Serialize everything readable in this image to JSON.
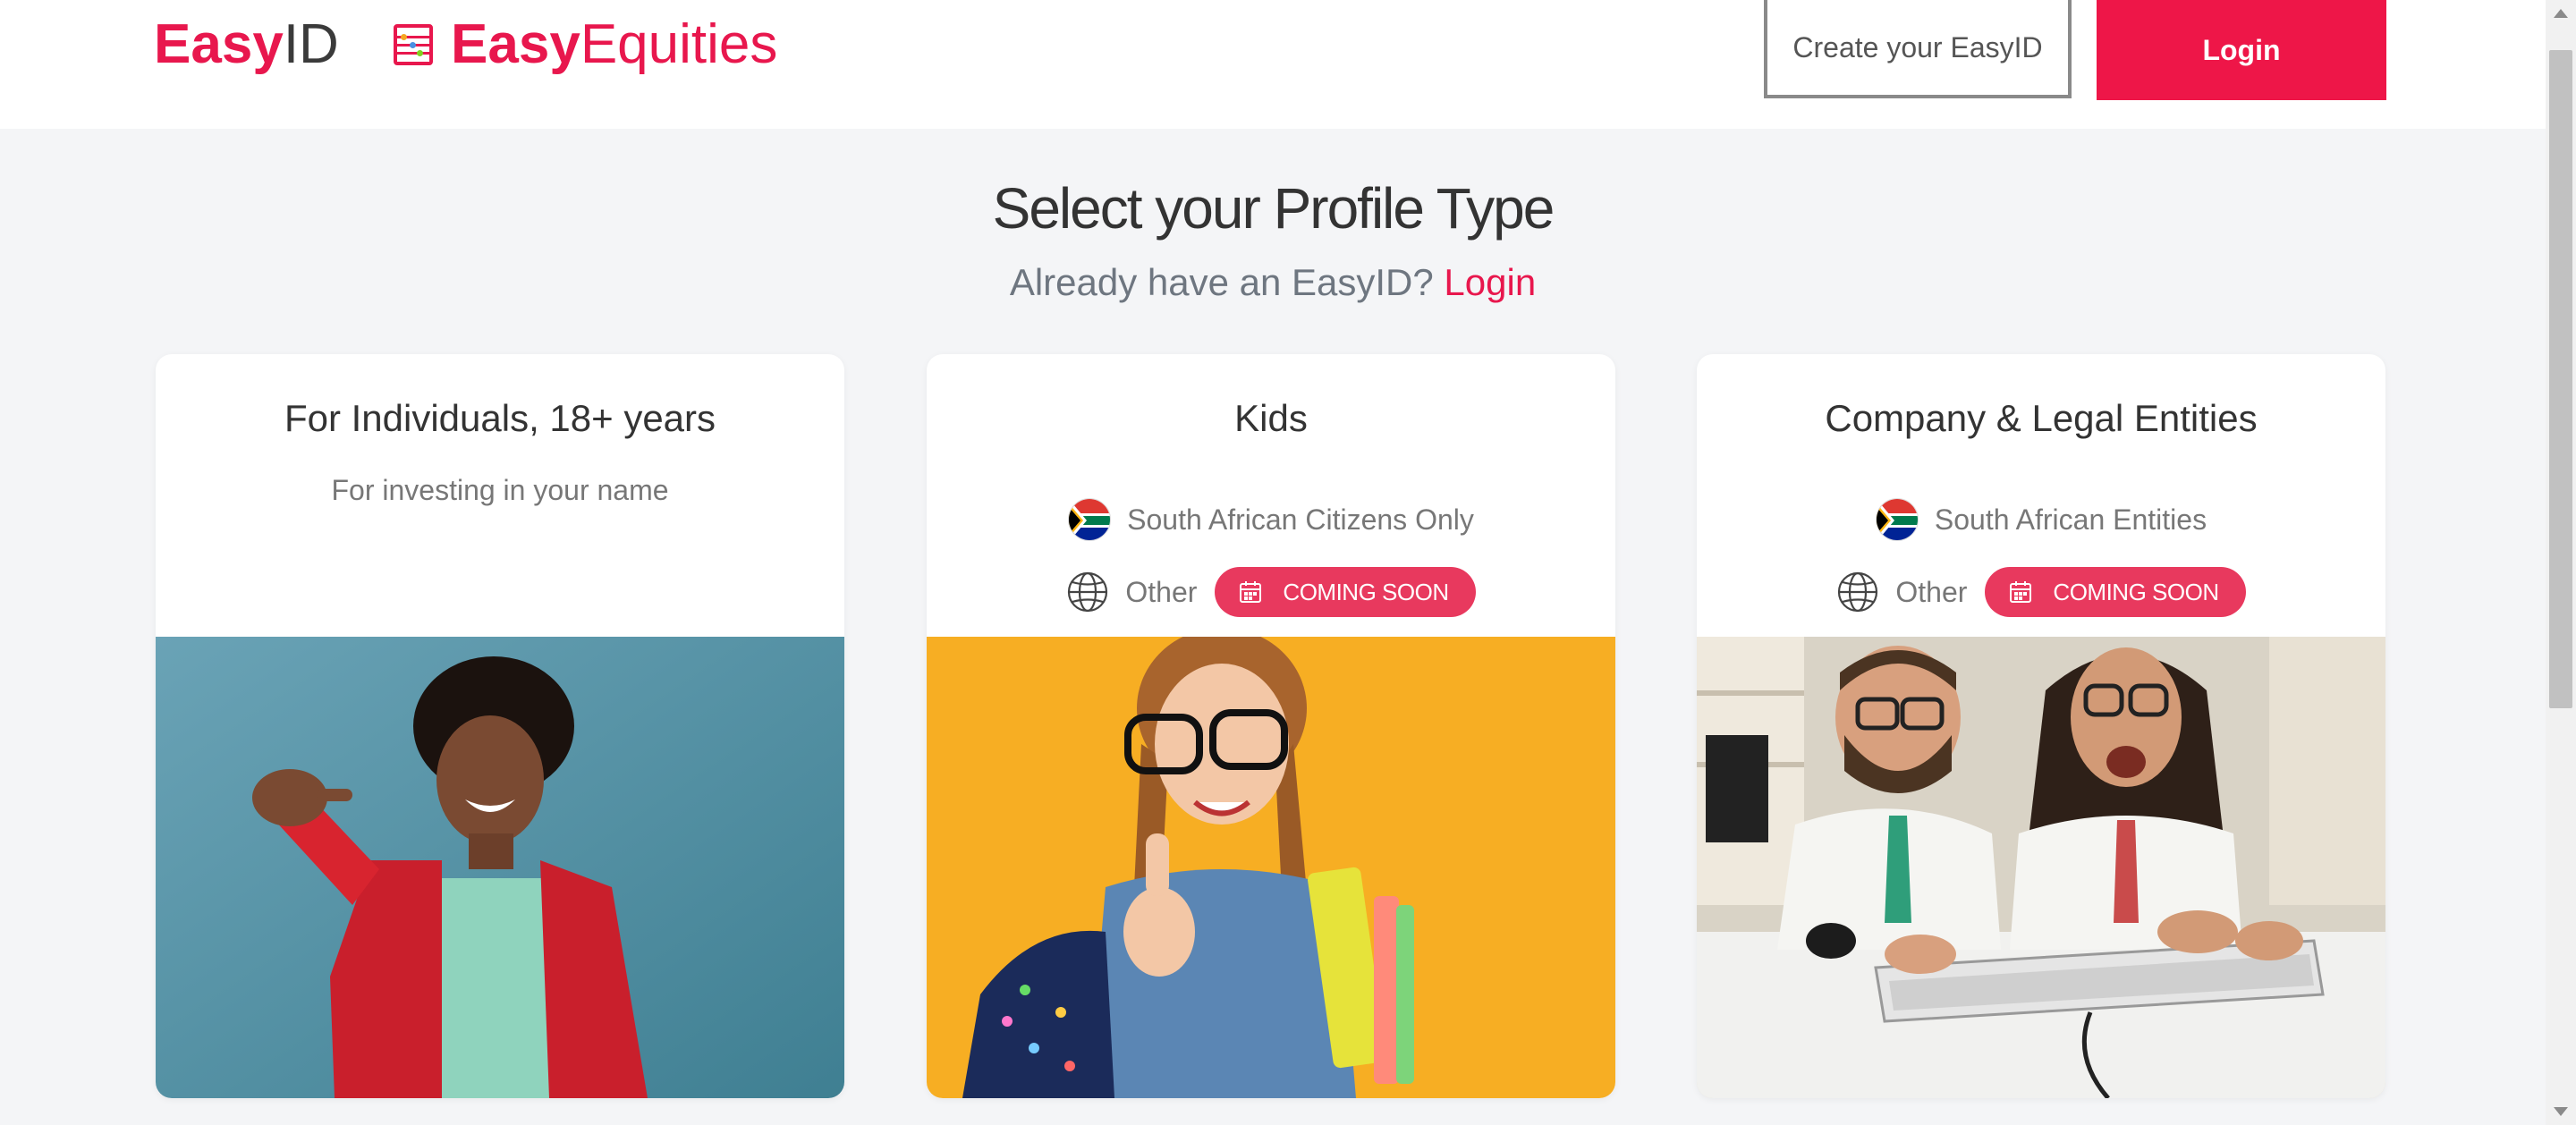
{
  "header": {
    "easyid_logo": {
      "bold": "Easy",
      "light": "ID"
    },
    "easyequities_logo": {
      "bold": "Easy",
      "light": "Equities",
      "icon": "abacus-icon"
    },
    "create_button": "Create your EasyID",
    "login_button": "Login"
  },
  "main": {
    "title": "Select your Profile Type",
    "subtitle_prefix": "Already have an EasyID?",
    "subtitle_link": "Login"
  },
  "cards": [
    {
      "title": "For Individuals, 18+ years",
      "description": "For investing in your name",
      "image": "man-pointing-red-jacket"
    },
    {
      "title": "Kids",
      "option_sa": "South African Citizens Only",
      "option_other": "Other",
      "badge": "COMING SOON",
      "image": "girl-thumbs-up"
    },
    {
      "title": "Company & Legal Entities",
      "option_sa": "South African Entities",
      "option_other": "Other",
      "badge": "COMING SOON",
      "image": "two-men-keyboard"
    }
  ],
  "colors": {
    "brand": "#e8174d",
    "background": "#f4f5f7",
    "badge": "#e8395e"
  }
}
